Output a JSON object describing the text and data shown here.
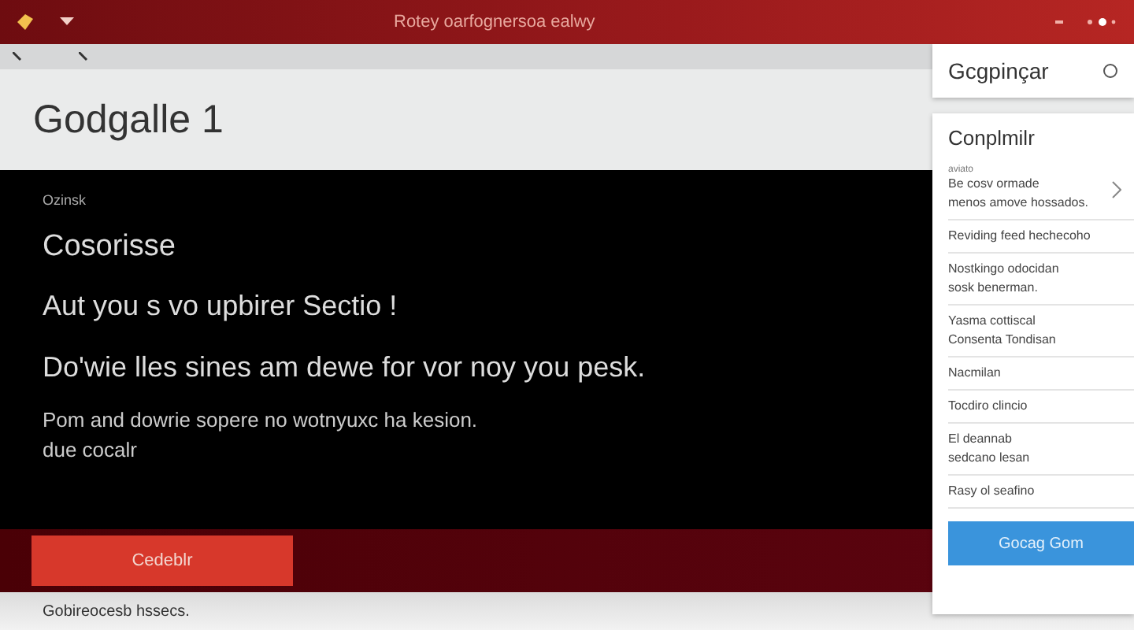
{
  "window": {
    "title": "Rotey oarfognersoa ealwy"
  },
  "header": {
    "title": "Godgalle 1"
  },
  "content": {
    "label": "Ozinsk",
    "heading": "Cosorisse",
    "subheading": "Aut you s vo upbirer Sectio !",
    "lead": "Do'wie lles sines am dewe for vor noy you pesk.",
    "body": "Pom and dowrie sopere no wotnyuxc ha kesion.\ndue cocalr",
    "button": "Cedeblr"
  },
  "footer": {
    "text": "Gobireocesb hssecs."
  },
  "search": {
    "value": "Gcgpinçar"
  },
  "panel": {
    "title": "Conplmilr",
    "items": [
      {
        "caption": "aviato",
        "text": "Be cosv ormade\nmenos amove hossados.",
        "chevron": true
      },
      {
        "text": "Reviding feed hechecoho",
        "chevron": false
      },
      {
        "text": "Nostkingo odocidan\nsosk benerman.",
        "chevron": false
      },
      {
        "text": "Yasma cottiscal\nConsenta Tondisan",
        "chevron": false
      },
      {
        "text": "Nacmilan",
        "chevron": false
      },
      {
        "text": "Tocdiro clincio",
        "chevron": false
      },
      {
        "text": "El deannab\nsedcano lesan",
        "chevron": false
      },
      {
        "text": "Rasy ol seafino",
        "chevron": false
      }
    ],
    "button": "Gocag Gom"
  }
}
